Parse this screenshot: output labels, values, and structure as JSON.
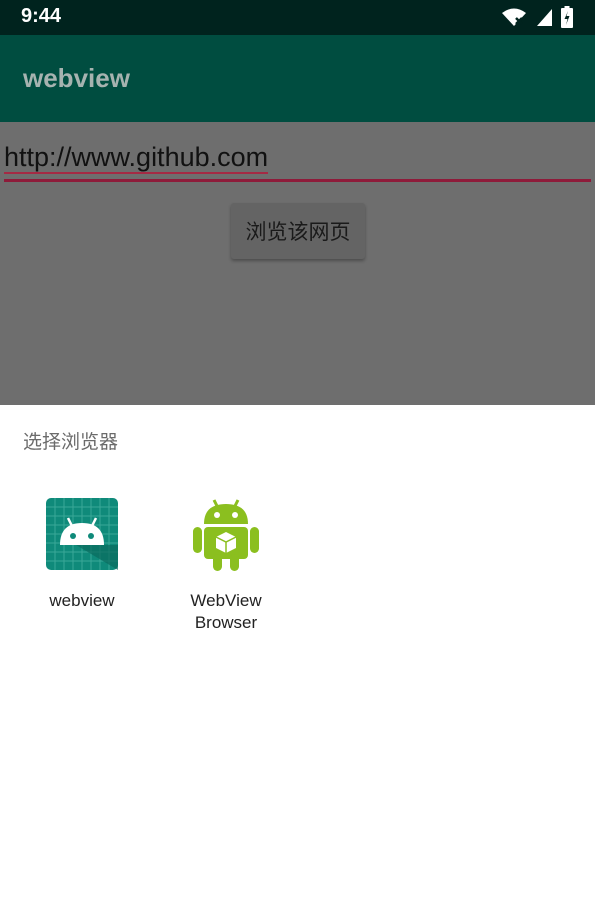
{
  "status_bar": {
    "time": "9:44"
  },
  "app_bar": {
    "title": "webview"
  },
  "main": {
    "url_value": "http://www.github.com",
    "browse_button": "浏览该网页"
  },
  "chooser": {
    "title": "选择浏览器",
    "apps": [
      {
        "label": "webview",
        "icon": "android-app-icon"
      },
      {
        "label": "WebView\nBrowser",
        "icon": "android-robot-icon"
      }
    ]
  },
  "colors": {
    "status_bar": "#00231e",
    "app_bar": "#004d40",
    "accent": "#8e1b3a",
    "scrim": "#6e6e6e"
  }
}
